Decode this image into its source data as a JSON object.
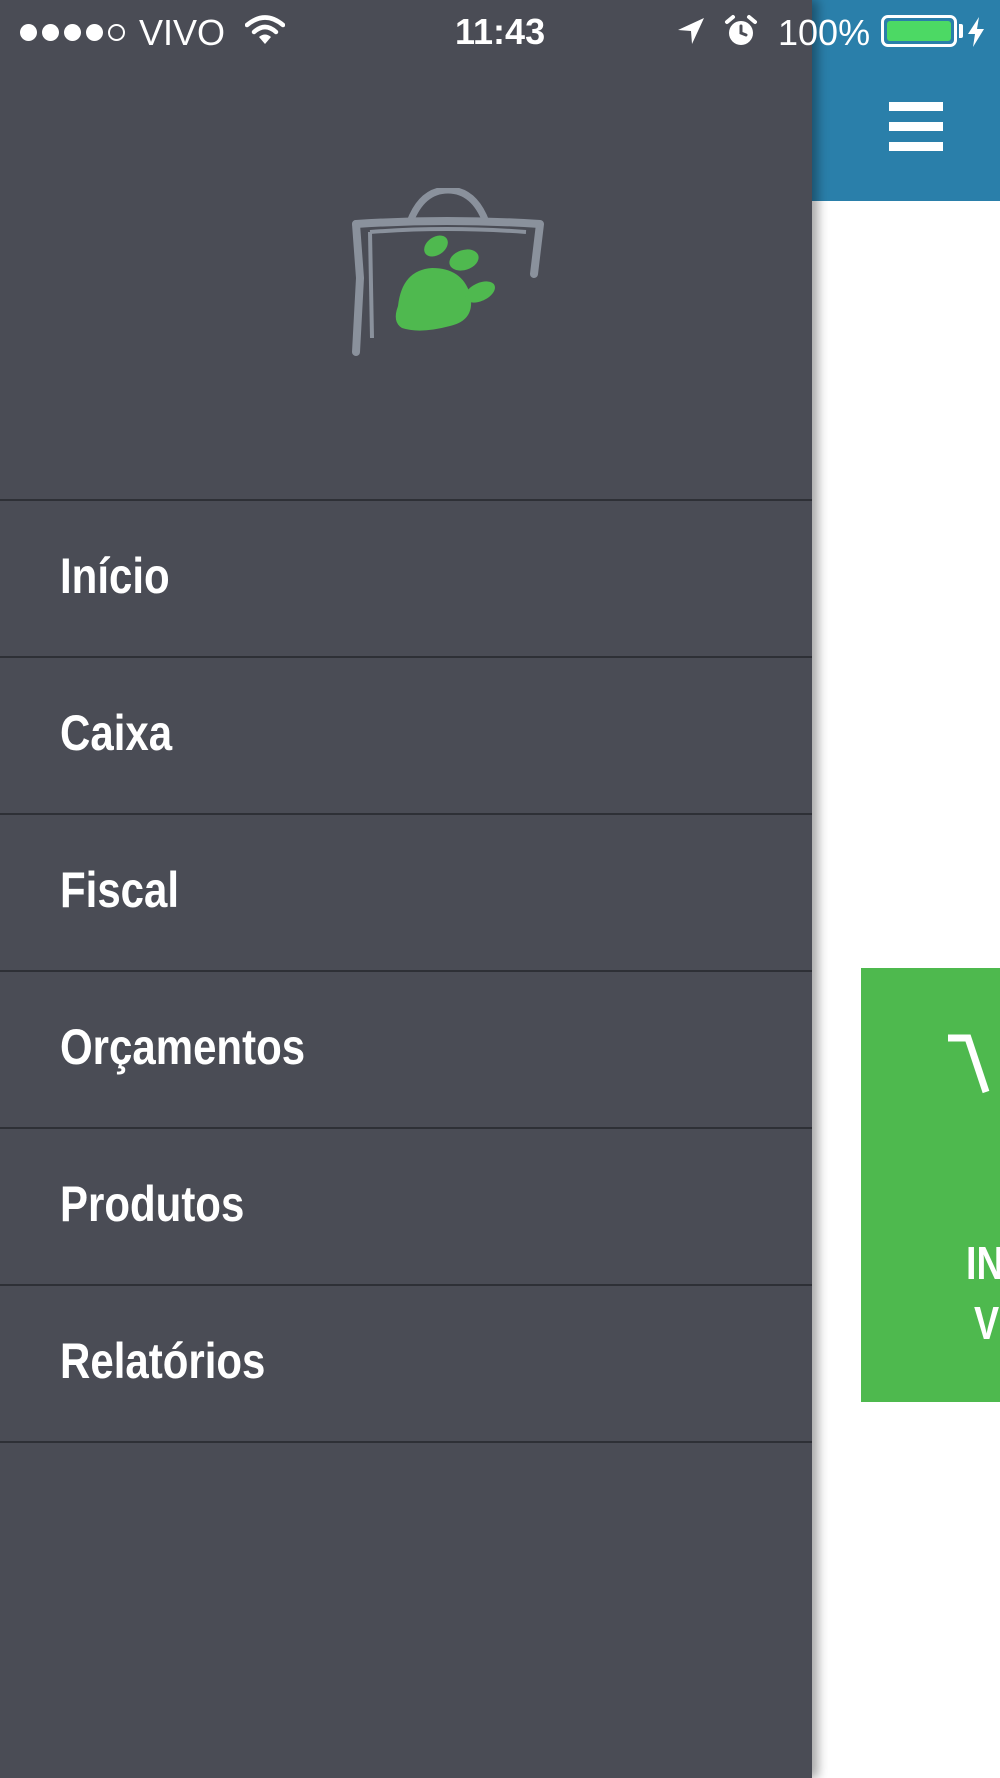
{
  "status_bar": {
    "carrier": "VIVO",
    "time": "11:43",
    "battery_percent": "100%",
    "signal_bars_filled": 4,
    "signal_bars_total": 5,
    "icons": [
      "wifi-icon",
      "location-icon",
      "alarm-icon",
      "battery-icon",
      "charging-icon"
    ]
  },
  "drawer": {
    "logo": "paw-shopping-bag-logo",
    "menu": [
      {
        "label": "Início"
      },
      {
        "label": "Caixa"
      },
      {
        "label": "Fiscal"
      },
      {
        "label": "Orçamentos"
      },
      {
        "label": "Produtos"
      },
      {
        "label": "Relatórios"
      }
    ]
  },
  "main": {
    "topbar": {
      "menu_icon": "hamburger-icon"
    },
    "card": {
      "line_1": "IN",
      "line_2": "V"
    }
  },
  "colors": {
    "drawer_bg": "#4a4c55",
    "topbar_bg": "#2a7faa",
    "card_bg": "#4eb94e",
    "logo_green": "#4fb94f",
    "logo_gray": "#8a919c",
    "battery_fill": "#4cd964"
  }
}
